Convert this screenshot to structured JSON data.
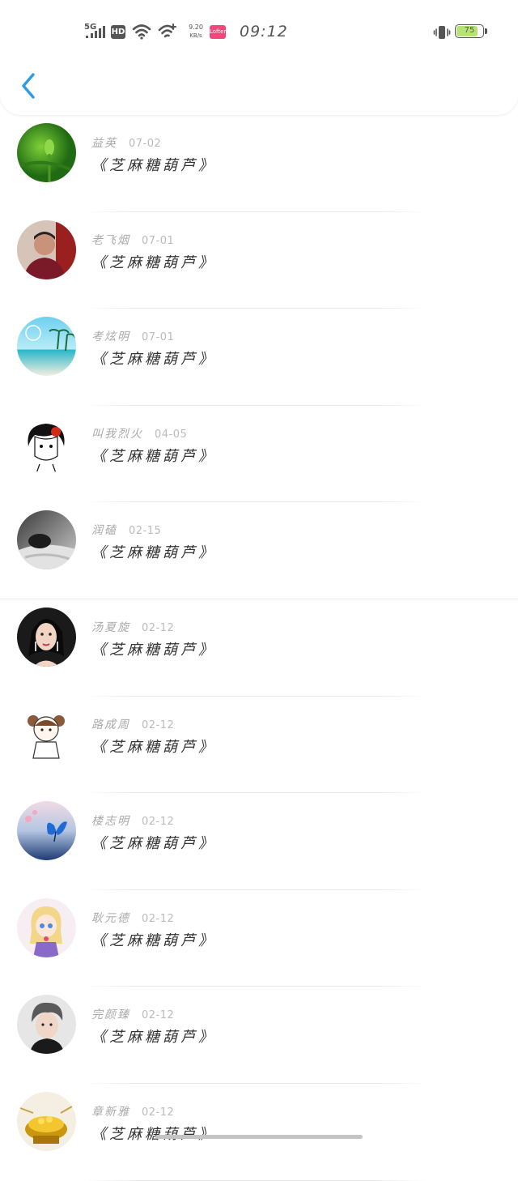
{
  "status_bar": {
    "network": "5G",
    "hd": "HD",
    "speed_value": "9.20",
    "speed_unit": "KB/s",
    "app_badge": "Lofter",
    "time": "09:12",
    "battery": "75",
    "battery_level": 0.75
  },
  "header": {
    "back_icon": "chevron-left-icon",
    "accent": "#2c9be8"
  },
  "items": [
    {
      "name": "益英",
      "date": "07-02",
      "title": "《芝麻糖葫芦》",
      "avatar": "lotus-bud-avatar"
    },
    {
      "name": "老飞烟",
      "date": "07-01",
      "title": "《芝麻糖葫芦》",
      "avatar": "elderly-woman-avatar"
    },
    {
      "name": "考炫明",
      "date": "07-01",
      "title": "《芝麻糖葫芦》",
      "avatar": "beach-august-avatar"
    },
    {
      "name": "叫我烈火",
      "date": "04-05",
      "title": "《芝麻糖葫芦》",
      "avatar": "cartoon-girl-avatar"
    },
    {
      "name": "润磕",
      "date": "02-15",
      "title": "《芝麻糖葫芦》",
      "avatar": "sleeping-person-avatar"
    },
    {
      "name": "汤夏旋",
      "date": "02-12",
      "title": "《芝麻糖葫芦》",
      "avatar": "woman-portrait-avatar"
    },
    {
      "name": "路成周",
      "date": "02-12",
      "title": "《芝麻糖葫芦》",
      "avatar": "panda-girl-avatar"
    },
    {
      "name": "楼志明",
      "date": "02-12",
      "title": "《芝麻糖葫芦》",
      "avatar": "blue-butterfly-avatar"
    },
    {
      "name": "耿元德",
      "date": "02-12",
      "title": "《芝麻糖葫芦》",
      "avatar": "anime-girl-avatar"
    },
    {
      "name": "完颜臻",
      "date": "02-12",
      "title": "《芝麻糖葫芦》",
      "avatar": "young-man-avatar"
    },
    {
      "name": "章新雅",
      "date": "02-12",
      "title": "《芝麻糖葫芦》",
      "avatar": "golden-dessert-avatar"
    }
  ]
}
